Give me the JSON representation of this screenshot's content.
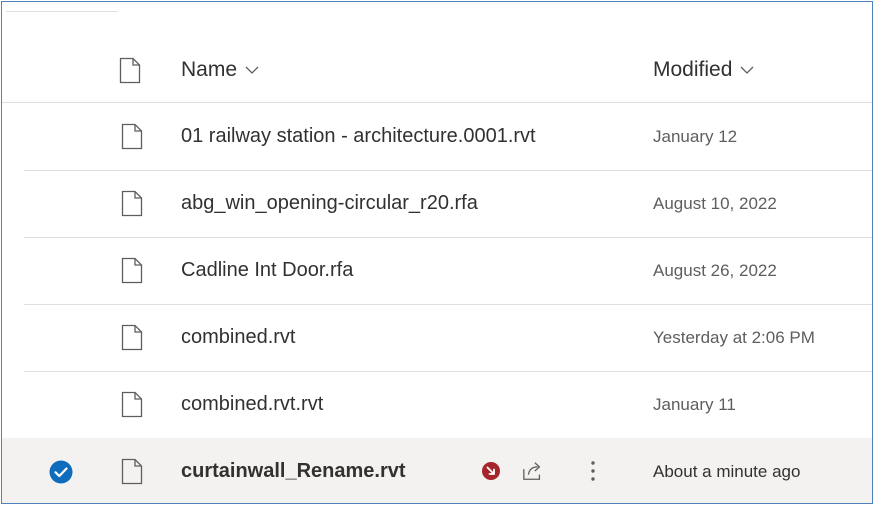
{
  "header": {
    "name_label": "Name",
    "modified_label": "Modified"
  },
  "files": [
    {
      "name": "01 railway station - architecture.0001.rvt",
      "modified": "January 12"
    },
    {
      "name": "abg_win_opening-circular_r20.rfa",
      "modified": "August 10, 2022"
    },
    {
      "name": "Cadline Int Door.rfa",
      "modified": "August 26, 2022"
    },
    {
      "name": "combined.rvt",
      "modified": "Yesterday at 2:06 PM"
    },
    {
      "name": "combined.rvt.rvt",
      "modified": "January 11"
    },
    {
      "name": "curtainwall_Rename.rvt",
      "modified": "About a minute ago",
      "selected": true
    }
  ],
  "colors": {
    "accent": "#0f6cbd",
    "blocked": "#a4262c",
    "border": "#4f81bd",
    "selected_row": "#f3f2f1"
  },
  "icons": {
    "file": "file-icon",
    "chevron": "chevron-down-icon",
    "check": "checkmark-circle-icon",
    "blocked": "blocked-icon",
    "share": "share-icon",
    "more": "more-vertical-icon"
  }
}
